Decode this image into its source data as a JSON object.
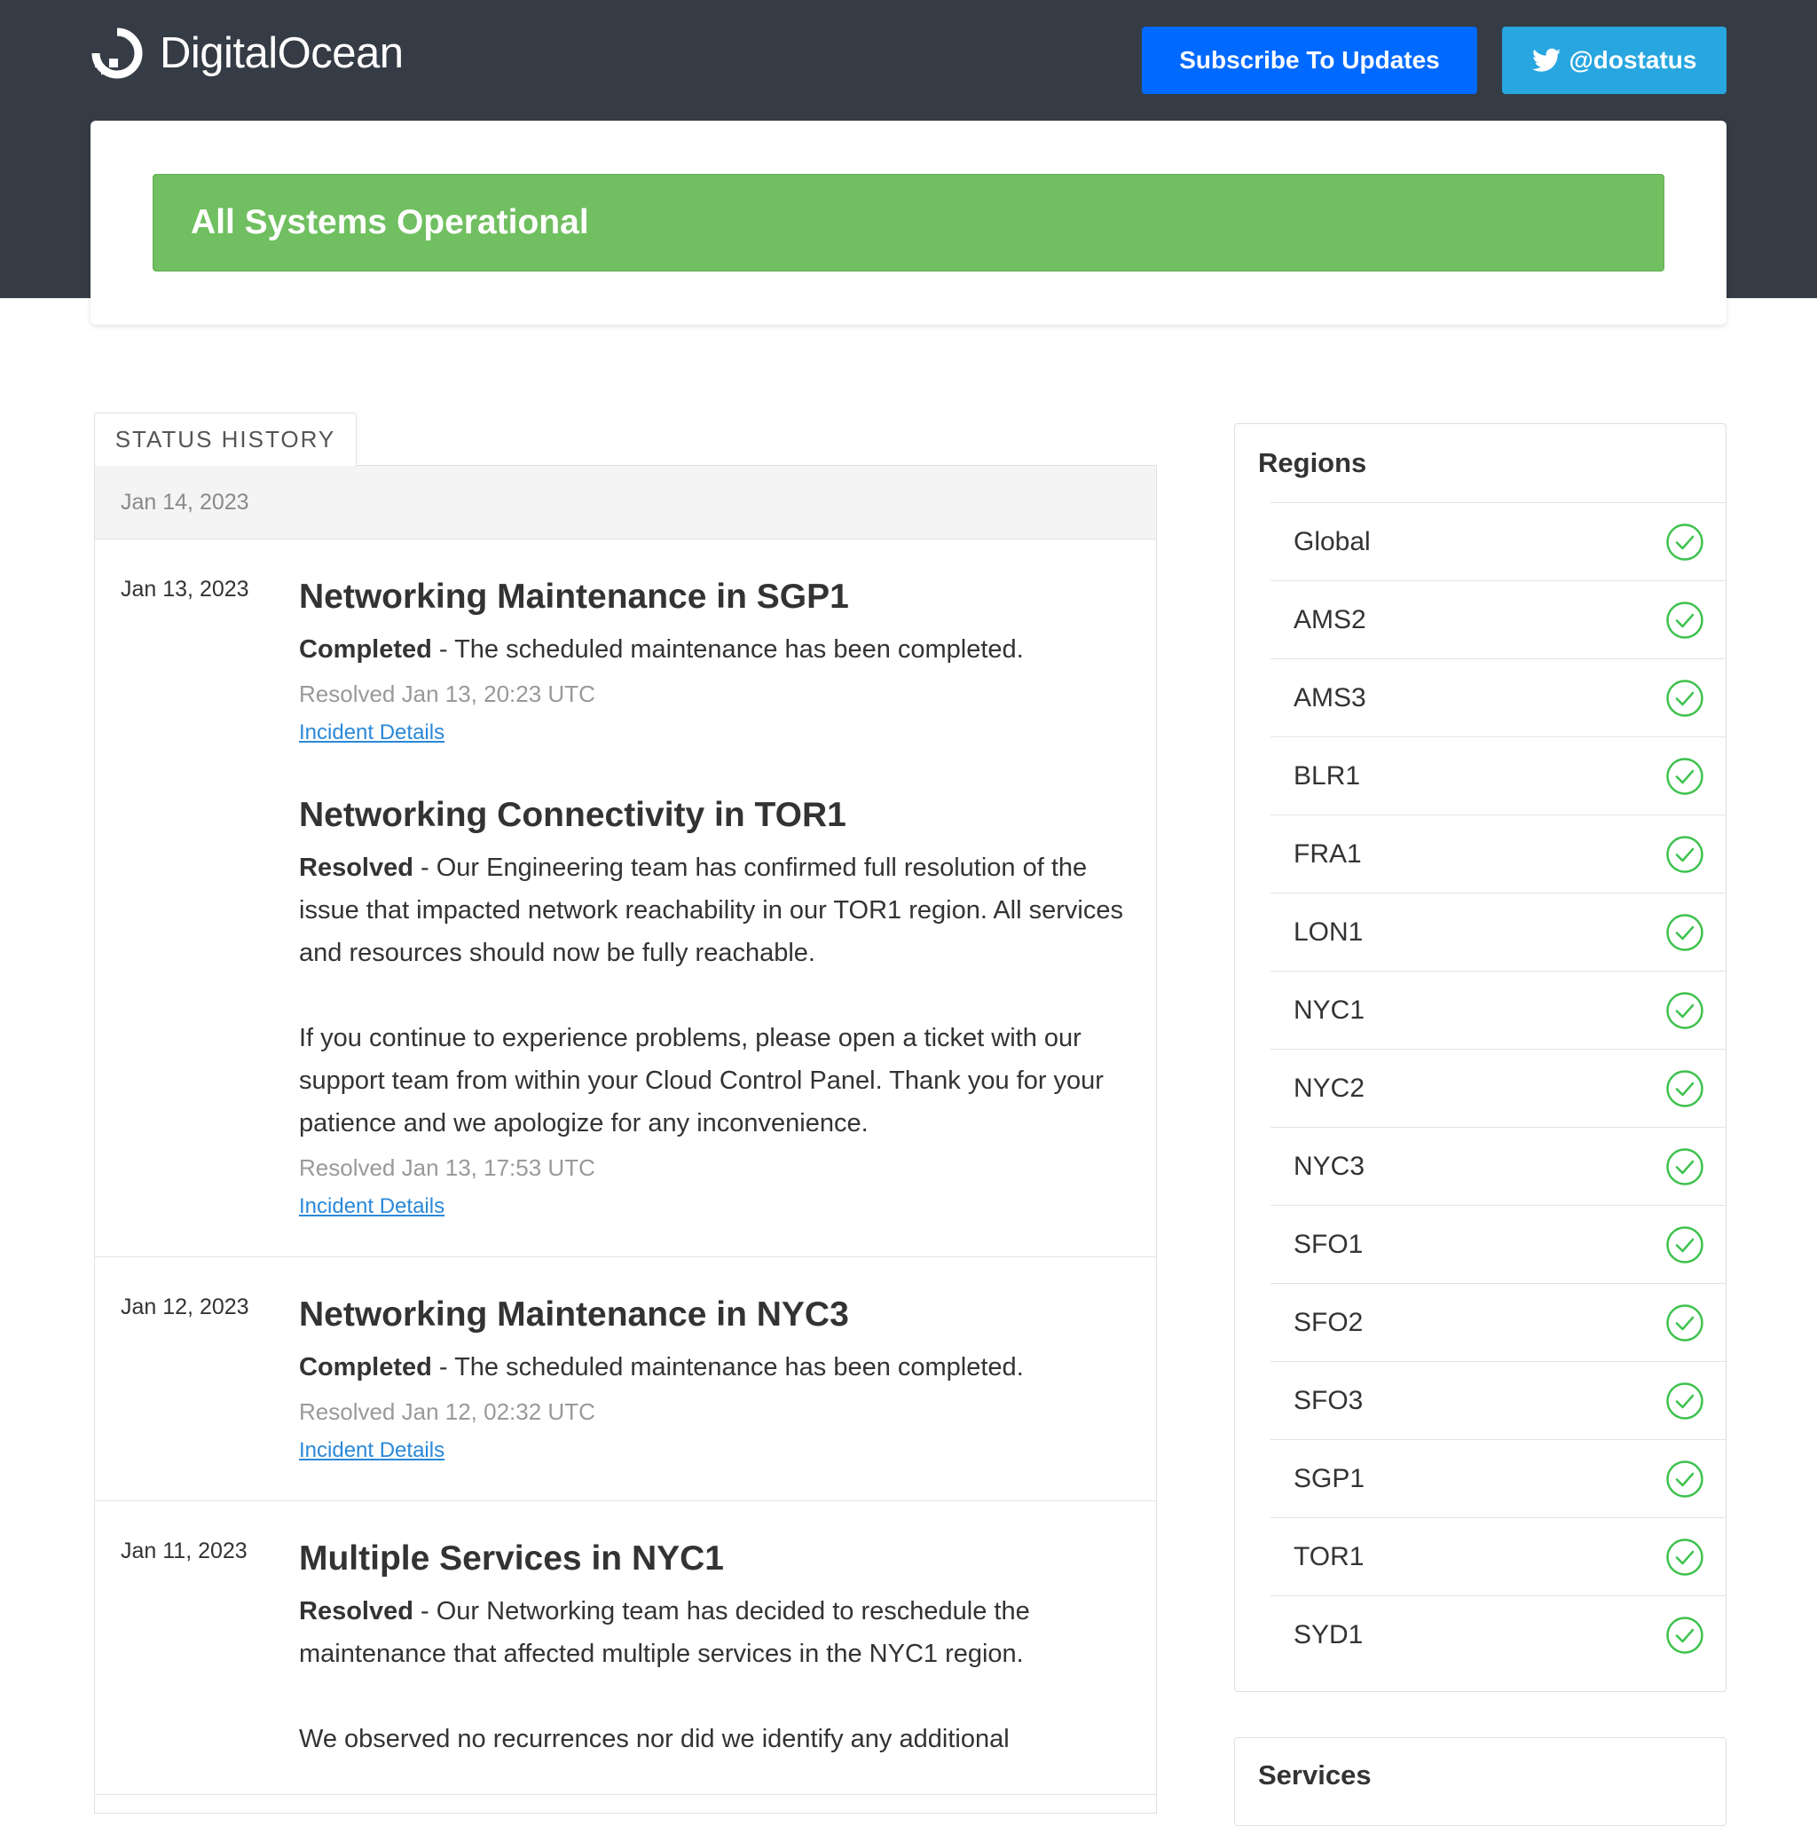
{
  "header": {
    "logo_text": "DigitalOcean",
    "subscribe_label": "Subscribe To Updates",
    "twitter_label": "@dostatus"
  },
  "status": {
    "text": "All Systems Operational"
  },
  "history": {
    "tab_label": "STATUS HISTORY",
    "top_date": "Jan 14, 2023",
    "days": [
      {
        "date": "Jan 13, 2023",
        "incidents": [
          {
            "title": "Networking Maintenance in SGP1",
            "status": "Completed",
            "message": " - The scheduled maintenance has been completed.",
            "extra": "",
            "resolved": "Resolved Jan 13, 20:23 UTC",
            "link": "Incident Details"
          },
          {
            "title": "Networking Connectivity in TOR1",
            "status": "Resolved",
            "message": " - Our Engineering team has confirmed full resolution of the issue that impacted network reachability in our TOR1 region. All services and resources should now be fully reachable.",
            "extra": "If you continue to experience problems, please open a ticket with our support team from within your Cloud Control Panel. Thank you for your patience and we apologize for any inconvenience.",
            "resolved": "Resolved Jan 13, 17:53 UTC",
            "link": "Incident Details"
          }
        ]
      },
      {
        "date": "Jan 12, 2023",
        "incidents": [
          {
            "title": "Networking Maintenance in NYC3",
            "status": "Completed",
            "message": " - The scheduled maintenance has been completed.",
            "extra": "",
            "resolved": "Resolved Jan 12, 02:32 UTC",
            "link": "Incident Details"
          }
        ]
      },
      {
        "date": "Jan 11, 2023",
        "incidents": [
          {
            "title": "Multiple Services in NYC1",
            "status": "Resolved",
            "message": " - Our Networking team has decided to reschedule the maintenance that affected multiple services in the NYC1 region.",
            "extra": "We observed no recurrences nor did we identify any additional",
            "resolved": "",
            "link": ""
          }
        ]
      }
    ]
  },
  "regions": {
    "title": "Regions",
    "items": [
      "Global",
      "AMS2",
      "AMS3",
      "BLR1",
      "FRA1",
      "LON1",
      "NYC1",
      "NYC2",
      "NYC3",
      "SFO1",
      "SFO2",
      "SFO3",
      "SGP1",
      "TOR1",
      "SYD1"
    ],
    "status_icon": "check-circle-icon",
    "ok_color": "#3ec24e"
  },
  "services": {
    "title": "Services"
  }
}
